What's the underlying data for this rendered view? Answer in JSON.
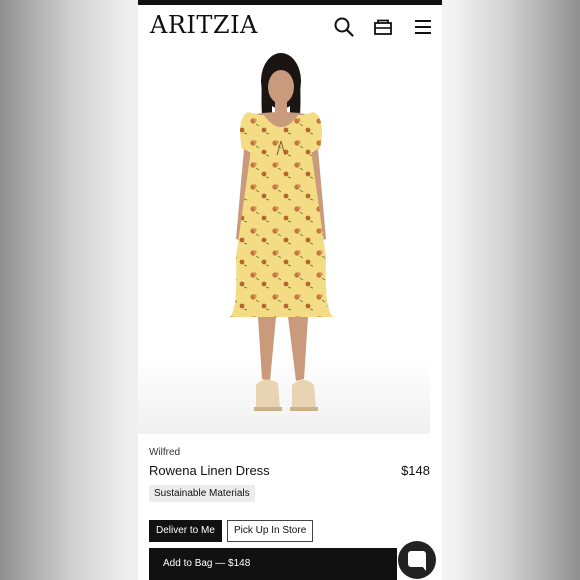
{
  "header": {
    "logo": "ARITZIA",
    "icons": [
      "search-icon",
      "bag-icon",
      "menu-icon"
    ]
  },
  "product": {
    "brand": "Wilfred",
    "name": "Rowena Linen Dress",
    "price": "$148",
    "badge": "Sustainable Materials",
    "dress_color": "#f3dc83",
    "flower_color": "#c0743a"
  },
  "actions": {
    "deliver": "Deliver to Me",
    "pickup": "Pick Up In Store",
    "add_to_bag": "Add to Bag — $148"
  },
  "chat": {
    "icon": "chat-icon"
  }
}
